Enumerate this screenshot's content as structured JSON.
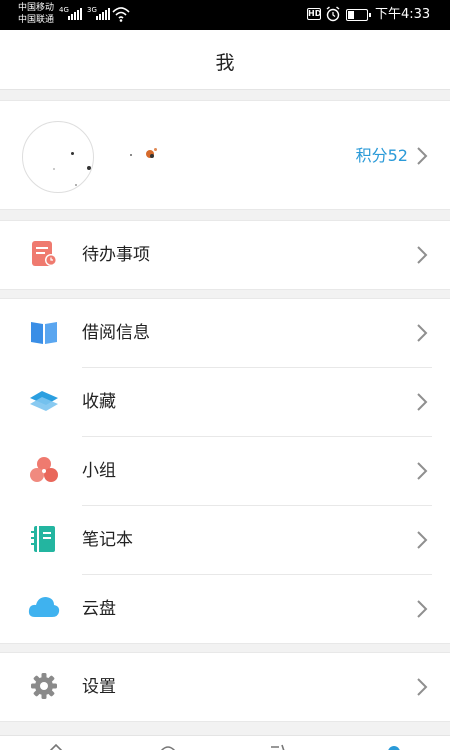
{
  "status_bar": {
    "carrier1": "中国移动",
    "carrier2": "中国联通",
    "net1": "4G",
    "net2": "3G",
    "hd_badge": "HD",
    "time": "下午4:33"
  },
  "header": {
    "title": "我"
  },
  "profile": {
    "points_label": "积分52"
  },
  "menu": {
    "todo": {
      "label": "待办事项",
      "icon": "todo-list-icon",
      "color": "#ef7a6f"
    },
    "borrow": {
      "label": "借阅信息",
      "icon": "book-icon",
      "color": "#3a8ee6"
    },
    "favorites": {
      "label": "收藏",
      "icon": "stack-icon",
      "color": "#2b9fe0"
    },
    "groups": {
      "label": "小组",
      "icon": "group-icon",
      "color": "#ef7a6f"
    },
    "notebook": {
      "label": "笔记本",
      "icon": "notebook-icon",
      "color": "#23b5a0"
    },
    "cloud": {
      "label": "云盘",
      "icon": "cloud-icon",
      "color": "#3fb2ef"
    },
    "settings": {
      "label": "设置",
      "icon": "gear-icon",
      "color": "#8a8a8a"
    }
  },
  "colors": {
    "accent": "#2a9ad8",
    "background": "#f2f2f2"
  }
}
